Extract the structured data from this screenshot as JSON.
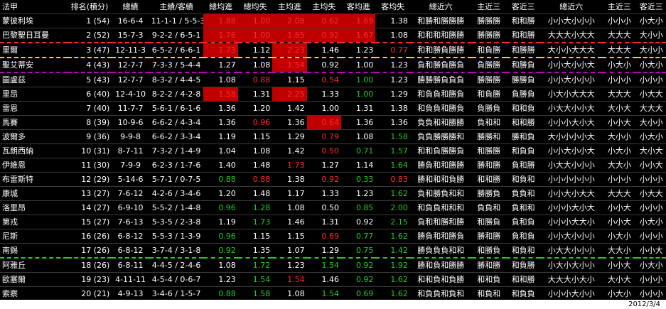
{
  "title": "法甲",
  "headers": [
    "法甲",
    "排名(積分)",
    "總績",
    "主績/客績",
    "總均進",
    "總均失",
    "主均進",
    "主均失",
    "客均進",
    "客均失",
    "總近六",
    "主近三",
    "客近三",
    "總近六",
    "主近三",
    "客近三"
  ],
  "colors": {
    "red_bg": "#c00000",
    "red_text": "#ff2a2a",
    "green_text": "#22cc22",
    "orange_sep": "#f2a33a",
    "yellow_dash": "#ffd400",
    "purple_dash": "#c000c0"
  },
  "rows": [
    {
      "team": "蒙彼利埃",
      "rank": "1 (54)",
      "record": "16-6-4",
      "hr": "11-1-1 / 5-5-3",
      "vals": [
        "1.88",
        "1.00",
        "2.08",
        "0.62",
        "1.69",
        "1.38"
      ],
      "form6": "和勝和勝勝勝",
      "home3": "勝勝勝",
      "away3": "和和勝",
      "ou6": "小小大小小小",
      "hou3": "小小小",
      "aou3": "小大小",
      "dash": ""
    },
    {
      "team": "巴黎聖日耳曼",
      "rank": "2 (52)",
      "record": "15-7-3",
      "hr": "9-2-2 / 6-5-1",
      "vals": [
        "1.76",
        "1.00",
        "1.85",
        "0.92",
        "1.67",
        "1.08"
      ],
      "form6": "和和和和勝勝",
      "home3": "勝勝勝",
      "away3": "和和勝",
      "ou6": "大大大小大大",
      "hou3": "大大大",
      "aou3": "大小小",
      "dash": "red"
    },
    {
      "team": "里爾",
      "rank": "3 (47)",
      "record": "12-11-3",
      "hr": "6-5-2 / 6-6-1",
      "vals": [
        "1.73",
        "1.12",
        "2.23",
        "1.46",
        "1.23",
        "0.77"
      ],
      "form6": "和和勝負勝勝",
      "home3": "和負勝",
      "away3": "和勝勝",
      "ou6": "大小小大大大",
      "hou3": "大大大",
      "aou3": "大小小",
      "dash": "yellow"
    },
    {
      "team": "聖艾蒂安",
      "rank": "4 (43)",
      "record": "12-7-7",
      "hr": "7-3-3 / 5-4-4",
      "vals": [
        "1.27",
        "1.08",
        "1.54",
        "0.92",
        "1.00",
        "1.23"
      ],
      "form6": "負和勝負勝負",
      "home3": "負勝勝",
      "away3": "和勝負",
      "ou6": "小小大小小大",
      "hou3": "小大小",
      "aou3": "小大小",
      "dash": "purple"
    },
    {
      "team": "圖盧茲",
      "rank": "5 (43)",
      "record": "12-7-7",
      "hr": "8-3-2 / 4-4-5",
      "vals": [
        "1.08",
        "0.88",
        "1.15",
        "0.54",
        "1.00",
        "1.23"
      ],
      "form6": "勝勝勝負負負",
      "home3": "勝勝勝",
      "away3": "勝勝負",
      "ou6": "小小大小小小",
      "hou3": "小小小",
      "aou3": "小小小",
      "dash": ""
    },
    {
      "team": "里昂",
      "rank": "6 (40)",
      "record": "12-4-10",
      "hr": "8-2-2 / 4-2-8",
      "vals": [
        "1.58",
        "1.31",
        "2.25",
        "1.33",
        "1.00",
        "1.29"
      ],
      "form6": "和負負和勝負",
      "home3": "和負勝",
      "away3": "負勝負",
      "ou6": "小大小大大大",
      "hou3": "大大大",
      "aou3": "小大大",
      "dash": ""
    },
    {
      "team": "雷恩",
      "rank": "7 (40)",
      "record": "11-7-7",
      "hr": "5-6-1 / 6-1-6",
      "vals": [
        "1.36",
        "1.20",
        "1.42",
        "1.00",
        "1.31",
        "1.38"
      ],
      "form6": "和負負和勝負",
      "home3": "負勝負",
      "away3": "和和負",
      "ou6": "小大大小小大",
      "hou3": "大小大",
      "aou3": "大大大",
      "dash": ""
    },
    {
      "team": "馬賽",
      "rank": "8 (39)",
      "record": "10-9-6",
      "hr": "6-6-2 / 4-3-4",
      "vals": [
        "1.36",
        "0.96",
        "1.36",
        "0.64",
        "1.36",
        "1.36"
      ],
      "form6": "負負和和勝勝",
      "home3": "負和和",
      "away3": "和和勝",
      "ou6": "小小小大小大",
      "hou3": "小小大",
      "aou3": "大小小",
      "dash": ""
    },
    {
      "team": "波爾多",
      "rank": "9 (36)",
      "record": "9-9-8",
      "hr": "6-6-2 / 3-3-4",
      "vals": [
        "1.19",
        "1.15",
        "1.29",
        "0.79",
        "1.08",
        "1.58"
      ],
      "form6": "負負勝勝勝和",
      "home3": "勝勝和",
      "away3": "勝和負",
      "ou6": "大小小小小大",
      "hou3": "大小小",
      "aou3": "小大小",
      "dash": ""
    },
    {
      "team": "瓦朗西納",
      "rank": "10 (31)",
      "record": "8-7-11",
      "hr": "7-3-2 / 1-4-9",
      "vals": [
        "1.04",
        "1.08",
        "1.42",
        "0.50",
        "0.71",
        "1.57"
      ],
      "form6": "和和負勝勝負",
      "home3": "和勝勝",
      "away3": "和負負",
      "ou6": "小小大小小大",
      "hou3": "小大小",
      "aou3": "大小大",
      "dash": ""
    },
    {
      "team": "伊維恩",
      "rank": "11 (30)",
      "record": "7-9-9",
      "hr": "6-2-3 / 1-7-6",
      "vals": [
        "1.40",
        "1.48",
        "1.73",
        "1.27",
        "1.14",
        "1.64"
      ],
      "form6": "勝負和和勝勝",
      "home3": "勝和勝",
      "away3": "負和勝",
      "ou6": "小大大小小小",
      "hou3": "大大小",
      "aou3": "小小大",
      "dash": ""
    },
    {
      "team": "布雷斯特",
      "rank": "12 (29)",
      "record": "5-14-6",
      "hr": "5-7-1 / 0-7-5",
      "vals": [
        "0.88",
        "0.88",
        "1.38",
        "0.92",
        "0.33",
        "0.83"
      ],
      "form6": "勝和和和負勝",
      "home3": "和和勝",
      "away3": "和負和",
      "ou6": "小小小小小小",
      "hou3": "小小小",
      "aou3": "小小小",
      "dash": ""
    },
    {
      "team": "康城",
      "rank": "13 (27)",
      "record": "7-6-12",
      "hr": "4-2-6 / 3-4-6",
      "vals": [
        "1.20",
        "1.48",
        "1.17",
        "1.33",
        "1.23",
        "1.62"
      ],
      "form6": "負和勝負和和",
      "home3": "勝勝負",
      "away3": "負負和",
      "ou6": "小小大小大大",
      "hou3": "大大大",
      "aou3": "小大大",
      "dash": ""
    },
    {
      "team": "洛里昂",
      "rank": "14 (27)",
      "record": "6-9-10",
      "hr": "5-5-2 / 1-4-8",
      "vals": [
        "0.96",
        "1.28",
        "1.08",
        "0.50",
        "0.85",
        "2.00"
      ],
      "form6": "和負負和和和",
      "home3": "負負和",
      "away3": "負和和",
      "ou6": "小小小大小大",
      "hou3": "小小大",
      "aou3": "小小小",
      "dash": ""
    },
    {
      "team": "第戎",
      "rank": "15 (27)",
      "record": "7-6-13",
      "hr": "5-3-5 / 2-3-8",
      "vals": [
        "1.19",
        "1.73",
        "1.46",
        "1.31",
        "0.92",
        "2.15"
      ],
      "form6": "負和和勝和勝",
      "home3": "和勝負",
      "away3": "負和負",
      "ou6": "小小小大大小",
      "hou3": "小小大",
      "aou3": "小大小",
      "dash": ""
    },
    {
      "team": "尼斯",
      "rank": "16 (26)",
      "record": "6-8-12",
      "hr": "5-5-3 / 1-3-9",
      "vals": [
        "0.96",
        "1.15",
        "1.15",
        "0.69",
        "0.77",
        "1.62"
      ],
      "form6": "勝負和和勝負",
      "home3": "勝和勝",
      "away3": "負和負",
      "ou6": "小小大小小小",
      "hou3": "小大小",
      "aou3": "小小小",
      "dash": ""
    },
    {
      "team": "南錫",
      "rank": "17 (26)",
      "record": "6-8-12",
      "hr": "3-7-4 / 3-1-8",
      "vals": [
        "0.92",
        "1.35",
        "1.07",
        "1.29",
        "0.75",
        "1.42"
      ],
      "form6": "勝負負負和和",
      "home3": "和勝負",
      "away3": "和負和",
      "ou6": "小大大小小小",
      "hou3": "大大小",
      "aou3": "小小大",
      "dash": "green"
    },
    {
      "team": "阿雅丘",
      "rank": "18 (26)",
      "record": "6-8-11",
      "hr": "4-4-5 / 2-4-6",
      "vals": [
        "1.08",
        "1.72",
        "1.23",
        "1.54",
        "0.92",
        "1.92"
      ],
      "form6": "勝和負和勝勝",
      "home3": "勝和勝",
      "away3": "和負勝",
      "ou6": "小大小大小小",
      "hou3": "小小大",
      "aou3": "小大小",
      "dash": ""
    },
    {
      "team": "歐塞爾",
      "rank": "19 (23)",
      "record": "4-11-11",
      "hr": "4-5-4 / 0-6-7",
      "vals": [
        "1.23",
        "1.54",
        "1.54",
        "1.46",
        "0.92",
        "1.62"
      ],
      "form6": "和和負和負勝",
      "home3": "和和負",
      "away3": "和和勝",
      "ou6": "大大大小大小",
      "hou3": "大小大",
      "aou3": "小小小",
      "dash": ""
    },
    {
      "team": "索察",
      "rank": "20 (21)",
      "record": "4-9-13",
      "hr": "3-4-6 / 1-5-7",
      "vals": [
        "0.88",
        "1.58",
        "1.08",
        "1.54",
        "0.69",
        "1.62"
      ],
      "form6": "和負負和負和",
      "home3": "和負和",
      "away3": "和負負",
      "ou6": "小小小大小小",
      "hou3": "小大小",
      "aou3": "小小小",
      "dash": ""
    }
  ],
  "cell_styles": [
    [
      "r",
      "r",
      "r",
      "r",
      "r",
      ""
    ],
    [
      "r",
      "r",
      "r",
      "r",
      "r",
      ""
    ],
    [
      "r",
      "",
      "r",
      "",
      "",
      "rt"
    ],
    [
      "",
      "",
      "r",
      "",
      "",
      ""
    ],
    [
      "",
      "rt",
      "",
      "rt",
      "g",
      ""
    ],
    [
      "r",
      "",
      "r",
      "",
      "g",
      ""
    ],
    [
      "",
      "",
      "",
      "",
      "",
      ""
    ],
    [
      "",
      "rt",
      "",
      "r",
      "",
      ""
    ],
    [
      "",
      "",
      "",
      "rt",
      "",
      "g"
    ],
    [
      "",
      "",
      "",
      "rt",
      "g",
      "g"
    ],
    [
      "",
      "",
      "rt",
      "",
      "",
      "g"
    ],
    [
      "g",
      "rt",
      "",
      "rt",
      "g",
      "rt"
    ],
    [
      "",
      "",
      "",
      "",
      "",
      "g"
    ],
    [
      "g",
      "g",
      "",
      "",
      "g",
      "g"
    ],
    [
      "",
      "g",
      "",
      "",
      "",
      "g"
    ],
    [
      "g",
      "",
      "",
      "rt",
      "g",
      "g"
    ],
    [
      "g",
      "",
      "",
      "",
      "g",
      "g"
    ],
    [
      "",
      "g",
      "",
      "g",
      "g",
      "g"
    ],
    [
      "",
      "g",
      "rt",
      "",
      "g",
      "g"
    ],
    [
      "g",
      "g",
      "",
      "g",
      "g",
      "g"
    ]
  ],
  "footer_date": "2012/3/4"
}
